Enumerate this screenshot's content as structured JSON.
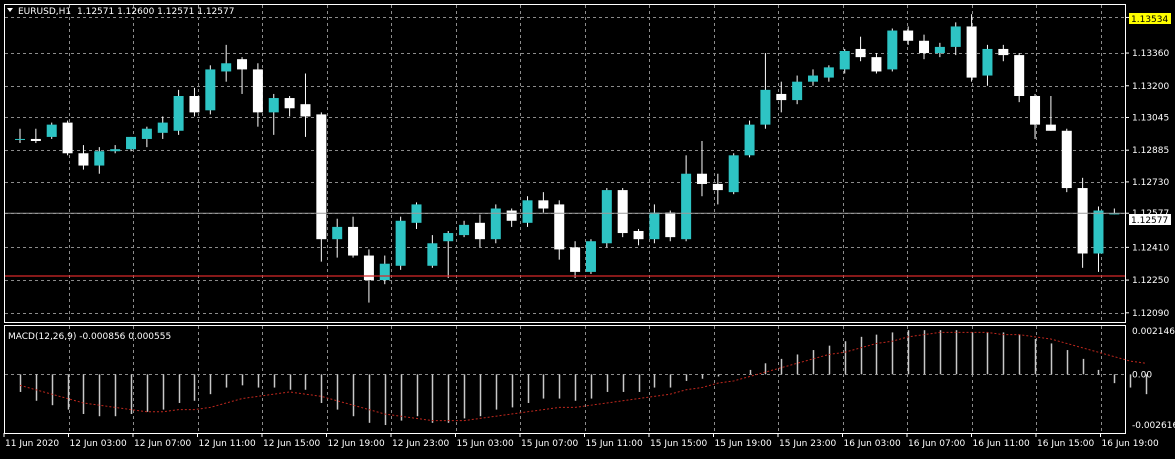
{
  "main_chart": {
    "symbol_label": "EURUSD,H1",
    "ohlc_text": "1.12571 1.12600 1.12571 1.12577",
    "current_price_label": "1.12577",
    "marked_price_label": "1.13534",
    "red_level": 1.1227
  },
  "price_axis": {
    "labels": [
      "1.13534",
      "1.13360",
      "1.13200",
      "1.13045",
      "1.12885",
      "1.12730",
      "1.12577",
      "1.12410",
      "1.12250",
      "1.12090"
    ]
  },
  "macd": {
    "title": "MACD(12,26,9) -0.000856 0.000555",
    "axis_labels": [
      "0.002146",
      "0.00",
      "-0.002616"
    ]
  },
  "time_axis": {
    "labels": [
      "11 Jun 2020",
      "12 Jun 03:00",
      "12 Jun 07:00",
      "12 Jun 11:00",
      "12 Jun 15:00",
      "12 Jun 19:00",
      "12 Jun 23:00",
      "15 Jun 03:00",
      "15 Jun 07:00",
      "15 Jun 11:00",
      "15 Jun 15:00",
      "15 Jun 19:00",
      "15 Jun 23:00",
      "16 Jun 03:00",
      "16 Jun 07:00",
      "16 Jun 11:00",
      "16 Jun 15:00",
      "16 Jun 19:00"
    ]
  },
  "colors": {
    "bull": "#2ec4c4",
    "bear": "#ffffff",
    "wick": "#ffffff",
    "grid": "#8c8c8c",
    "red_line": "#d62828",
    "signal": "#c0281e",
    "frame": "#ffffff",
    "marker_bg": "#ffff00"
  },
  "chart_data": [
    {
      "type": "candlestick",
      "name": "EURUSD,H1",
      "ylim": [
        1.1205,
        1.1359
      ],
      "candles": [
        {
          "o": 1.1294,
          "h": 1.1299,
          "l": 1.1292,
          "c": 1.1294
        },
        {
          "o": 1.1294,
          "h": 1.1299,
          "l": 1.1292,
          "c": 1.1293
        },
        {
          "o": 1.1295,
          "h": 1.1302,
          "l": 1.1294,
          "c": 1.1301
        },
        {
          "o": 1.1302,
          "h": 1.1303,
          "l": 1.1286,
          "c": 1.1287
        },
        {
          "o": 1.1287,
          "h": 1.1291,
          "l": 1.1279,
          "c": 1.1281
        },
        {
          "o": 1.1281,
          "h": 1.129,
          "l": 1.1277,
          "c": 1.1288
        },
        {
          "o": 1.1288,
          "h": 1.1291,
          "l": 1.1287,
          "c": 1.1289
        },
        {
          "o": 1.1289,
          "h": 1.1295,
          "l": 1.1288,
          "c": 1.1295
        },
        {
          "o": 1.1294,
          "h": 1.13,
          "l": 1.129,
          "c": 1.1299
        },
        {
          "o": 1.1297,
          "h": 1.1305,
          "l": 1.1294,
          "c": 1.1302
        },
        {
          "o": 1.1298,
          "h": 1.1318,
          "l": 1.1296,
          "c": 1.1315
        },
        {
          "o": 1.1315,
          "h": 1.1319,
          "l": 1.1305,
          "c": 1.1307
        },
        {
          "o": 1.1308,
          "h": 1.133,
          "l": 1.1306,
          "c": 1.1328
        },
        {
          "o": 1.1327,
          "h": 1.134,
          "l": 1.1322,
          "c": 1.1331
        },
        {
          "o": 1.1333,
          "h": 1.1334,
          "l": 1.1316,
          "c": 1.1328
        },
        {
          "o": 1.1328,
          "h": 1.1331,
          "l": 1.13,
          "c": 1.1307
        },
        {
          "o": 1.1307,
          "h": 1.1316,
          "l": 1.1296,
          "c": 1.1314
        },
        {
          "o": 1.1314,
          "h": 1.1315,
          "l": 1.1305,
          "c": 1.1309
        },
        {
          "o": 1.1311,
          "h": 1.1326,
          "l": 1.1295,
          "c": 1.1305
        },
        {
          "o": 1.1306,
          "h": 1.1307,
          "l": 1.1234,
          "c": 1.1245
        },
        {
          "o": 1.1245,
          "h": 1.1255,
          "l": 1.1236,
          "c": 1.1251
        },
        {
          "o": 1.1251,
          "h": 1.1256,
          "l": 1.1236,
          "c": 1.1237
        },
        {
          "o": 1.1237,
          "h": 1.124,
          "l": 1.1214,
          "c": 1.1225
        },
        {
          "o": 1.1225,
          "h": 1.1237,
          "l": 1.1223,
          "c": 1.1233
        },
        {
          "o": 1.1232,
          "h": 1.1256,
          "l": 1.123,
          "c": 1.1254
        },
        {
          "o": 1.1253,
          "h": 1.1263,
          "l": 1.125,
          "c": 1.1262
        },
        {
          "o": 1.1232,
          "h": 1.1247,
          "l": 1.1231,
          "c": 1.1243
        },
        {
          "o": 1.1244,
          "h": 1.1249,
          "l": 1.1226,
          "c": 1.1248
        },
        {
          "o": 1.1247,
          "h": 1.1254,
          "l": 1.1246,
          "c": 1.1252
        },
        {
          "o": 1.1253,
          "h": 1.1257,
          "l": 1.1241,
          "c": 1.1245
        },
        {
          "o": 1.1245,
          "h": 1.1262,
          "l": 1.1243,
          "c": 1.126
        },
        {
          "o": 1.1259,
          "h": 1.126,
          "l": 1.1251,
          "c": 1.1254
        },
        {
          "o": 1.1253,
          "h": 1.1266,
          "l": 1.1251,
          "c": 1.1264
        },
        {
          "o": 1.1264,
          "h": 1.1268,
          "l": 1.1258,
          "c": 1.126
        },
        {
          "o": 1.1262,
          "h": 1.1264,
          "l": 1.1235,
          "c": 1.124
        },
        {
          "o": 1.1241,
          "h": 1.1244,
          "l": 1.1226,
          "c": 1.1229
        },
        {
          "o": 1.1229,
          "h": 1.1245,
          "l": 1.1228,
          "c": 1.1244
        },
        {
          "o": 1.1243,
          "h": 1.127,
          "l": 1.1241,
          "c": 1.1269
        },
        {
          "o": 1.1269,
          "h": 1.127,
          "l": 1.1246,
          "c": 1.1248
        },
        {
          "o": 1.1249,
          "h": 1.125,
          "l": 1.1242,
          "c": 1.1245
        },
        {
          "o": 1.1245,
          "h": 1.1262,
          "l": 1.1243,
          "c": 1.1258
        },
        {
          "o": 1.1258,
          "h": 1.1259,
          "l": 1.1244,
          "c": 1.1246
        },
        {
          "o": 1.1245,
          "h": 1.1286,
          "l": 1.1244,
          "c": 1.1277
        },
        {
          "o": 1.1277,
          "h": 1.1293,
          "l": 1.1266,
          "c": 1.1272
        },
        {
          "o": 1.1272,
          "h": 1.1277,
          "l": 1.1262,
          "c": 1.1269
        },
        {
          "o": 1.1268,
          "h": 1.1287,
          "l": 1.1267,
          "c": 1.1286
        },
        {
          "o": 1.1286,
          "h": 1.1303,
          "l": 1.1285,
          "c": 1.1301
        },
        {
          "o": 1.1301,
          "h": 1.1336,
          "l": 1.1299,
          "c": 1.1318
        },
        {
          "o": 1.1316,
          "h": 1.1322,
          "l": 1.1307,
          "c": 1.1313
        },
        {
          "o": 1.1313,
          "h": 1.1325,
          "l": 1.1311,
          "c": 1.1322
        },
        {
          "o": 1.1322,
          "h": 1.1328,
          "l": 1.132,
          "c": 1.1325
        },
        {
          "o": 1.1324,
          "h": 1.133,
          "l": 1.1322,
          "c": 1.1329
        },
        {
          "o": 1.1328,
          "h": 1.1338,
          "l": 1.1326,
          "c": 1.1337
        },
        {
          "o": 1.1338,
          "h": 1.1344,
          "l": 1.1332,
          "c": 1.1334
        },
        {
          "o": 1.1334,
          "h": 1.1336,
          "l": 1.1326,
          "c": 1.1327
        },
        {
          "o": 1.1328,
          "h": 1.1348,
          "l": 1.1327,
          "c": 1.1347
        },
        {
          "o": 1.1347,
          "h": 1.1349,
          "l": 1.134,
          "c": 1.1342
        },
        {
          "o": 1.1342,
          "h": 1.1345,
          "l": 1.1333,
          "c": 1.1336
        },
        {
          "o": 1.1336,
          "h": 1.1341,
          "l": 1.1334,
          "c": 1.1339
        },
        {
          "o": 1.1339,
          "h": 1.1351,
          "l": 1.1335,
          "c": 1.1349
        },
        {
          "o": 1.1349,
          "h": 1.1355,
          "l": 1.1322,
          "c": 1.1324
        },
        {
          "o": 1.1325,
          "h": 1.134,
          "l": 1.132,
          "c": 1.1338
        },
        {
          "o": 1.1338,
          "h": 1.134,
          "l": 1.1332,
          "c": 1.1335
        },
        {
          "o": 1.1335,
          "h": 1.1336,
          "l": 1.1312,
          "c": 1.1315
        },
        {
          "o": 1.1315,
          "h": 1.1316,
          "l": 1.1294,
          "c": 1.1301
        },
        {
          "o": 1.1301,
          "h": 1.1315,
          "l": 1.1298,
          "c": 1.1298
        },
        {
          "o": 1.1298,
          "h": 1.1299,
          "l": 1.1268,
          "c": 1.127
        },
        {
          "o": 1.127,
          "h": 1.1275,
          "l": 1.1231,
          "c": 1.1238
        },
        {
          "o": 1.1238,
          "h": 1.1261,
          "l": 1.1229,
          "c": 1.1259
        },
        {
          "o": 1.12571,
          "h": 1.126,
          "l": 1.12571,
          "c": 1.12577
        }
      ]
    },
    {
      "type": "bar",
      "name": "MACD(12,26,9)",
      "ylim": [
        -0.002616,
        0.002146
      ],
      "values": [
        -0.0008,
        -0.0012,
        -0.0014,
        -0.0016,
        -0.0018,
        -0.0019,
        -0.0019,
        -0.0018,
        -0.0017,
        -0.0016,
        -0.0013,
        -0.0012,
        -0.0009,
        -0.0006,
        -0.0005,
        -0.0006,
        -0.0006,
        -0.0007,
        -0.0007,
        -0.0013,
        -0.0016,
        -0.0019,
        -0.0022,
        -0.0023,
        -0.0021,
        -0.0019,
        -0.0022,
        -0.0022,
        -0.002,
        -0.0019,
        -0.0016,
        -0.0015,
        -0.0013,
        -0.0011,
        -0.0011,
        -0.0012,
        -0.0011,
        -0.0008,
        -0.0008,
        -0.0008,
        -0.0006,
        -0.0006,
        -0.0003,
        -0.0002,
        -0.0001,
        0.0,
        0.0002,
        0.0005,
        0.0007,
        0.0009,
        0.0011,
        0.0013,
        0.0015,
        0.0017,
        0.0018,
        0.0019,
        0.002,
        0.002,
        0.002,
        0.002,
        0.0019,
        0.0019,
        0.0019,
        0.0018,
        0.0016,
        0.0014,
        0.0011,
        0.0007,
        0.0002,
        -0.0004,
        -0.0006,
        -0.0009
      ],
      "signal": [
        -0.0005,
        -0.0007,
        -0.0009,
        -0.0011,
        -0.0013,
        -0.0014,
        -0.0015,
        -0.0016,
        -0.0017,
        -0.0017,
        -0.0016,
        -0.0016,
        -0.0015,
        -0.0013,
        -0.0011,
        -0.001,
        -0.0009,
        -0.0008,
        -0.0009,
        -0.001,
        -0.0012,
        -0.0014,
        -0.0016,
        -0.0018,
        -0.0019,
        -0.002,
        -0.0021,
        -0.0021,
        -0.0021,
        -0.002,
        -0.0019,
        -0.0018,
        -0.0017,
        -0.0016,
        -0.0015,
        -0.0015,
        -0.0014,
        -0.0013,
        -0.0012,
        -0.0011,
        -0.001,
        -0.0009,
        -0.0007,
        -0.0006,
        -0.0004,
        -0.0003,
        -0.0001,
        0.0001,
        0.0003,
        0.0005,
        0.0007,
        0.0009,
        0.001,
        0.0012,
        0.0014,
        0.0015,
        0.0017,
        0.0018,
        0.0019,
        0.0019,
        0.0019,
        0.0019,
        0.0018,
        0.0018,
        0.0017,
        0.0016,
        0.0014,
        0.0012,
        0.001,
        0.0008,
        0.0006,
        0.0005
      ]
    }
  ]
}
